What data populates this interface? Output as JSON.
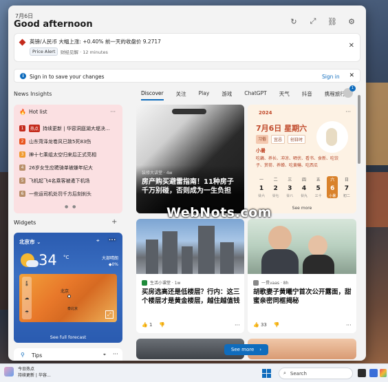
{
  "header": {
    "date": "7月6日",
    "greeting": "Good afternoon"
  },
  "alert": {
    "text": "英镑/人民币 大幅上涨: +0.40% 前一天的收盘价 9.2717",
    "pill": "Price Alert",
    "source": "财经见解 · 12 minutes"
  },
  "signin": {
    "text": "Sign in to save your changes",
    "link": "Sign in"
  },
  "left": {
    "news_label": "News Insights",
    "widgets_label": "Widgets"
  },
  "tabs": [
    "Discover",
    "关注",
    "Play",
    "游戏",
    "ChatGPT",
    "天气",
    "抖音",
    "携程旅行"
  ],
  "hotlist": {
    "title": "Hot list",
    "badge": "热点",
    "items": [
      {
        "rank": "1",
        "text": "持续更新 | 华容洞庭湖大堤决…",
        "color": "#c42b1c"
      },
      {
        "rank": "2",
        "text": "山东菏泽龙卷风已致5死83伤",
        "color": "#e8551f"
      },
      {
        "rank": "3",
        "text": "神十七乘组太空归来后正式亮相",
        "color": "#f09a2f"
      },
      {
        "rank": "4",
        "text": "26岁女生应聘骑单被嫌年纪大",
        "color": "#b88f6a"
      },
      {
        "rank": "5",
        "text": "飞机起飞4名乘客被遣下机场",
        "color": "#b88f6a"
      },
      {
        "rank": "6",
        "text": "一些运司机处罚千方后刻刹头",
        "color": "#b88f6a"
      }
    ]
  },
  "weather": {
    "city": "北京市",
    "temp": "34",
    "unit": "°C",
    "cond1": "大部晴朗",
    "cond2": "◆0%",
    "map_label": "北京",
    "map_sub": "泰北京",
    "forecast": "See full forecast"
  },
  "tips": {
    "label": "Tips"
  },
  "card_main": {
    "source": "装修大讲堂 · 4w",
    "title": "房产购买避雷指南！11种房子千万别碰，否则成为一生负担"
  },
  "calendar": {
    "year": "2024",
    "date": "7月6日 星期六",
    "yi": "习俗",
    "tag1": "宜忌",
    "tag2": "创日时",
    "season": "小暑",
    "acts": "吃藕、养长、冲凉、晒伏、看书、食新、吃饺子、赏荷、养蝉、吃黄鳝、吃西瓜",
    "days": [
      {
        "w": "一",
        "d": "1",
        "l": "廿六"
      },
      {
        "w": "二",
        "d": "2",
        "l": "廿七"
      },
      {
        "w": "三",
        "d": "3",
        "l": "廿八"
      },
      {
        "w": "四",
        "d": "4",
        "l": "廿九"
      },
      {
        "w": "五",
        "d": "5",
        "l": "三十"
      },
      {
        "w": "六",
        "d": "6",
        "l": "小暑"
      },
      {
        "w": "日",
        "d": "7",
        "l": "初二"
      }
    ],
    "see_more": "See more"
  },
  "card_a": {
    "source": "生活小课堂 · 1w",
    "title": "买房选高还是低楼层？行内：这三个楼层才是黄金楼层，越住越值钱",
    "likes": "1"
  },
  "card_b": {
    "source": "一贯vaas · 8h",
    "title": "胡歌妻子黄曦宁首次公开露面，甜蜜亲密同框揭秘",
    "likes": "33"
  },
  "see_more_btn": "See more",
  "watermark": "WebNots.com",
  "taskbar": {
    "news1": "今日热点",
    "news2": "持续更新 | 华容…",
    "search": "Search"
  },
  "colors": {
    "accent": "#0f6cbd",
    "alert": "#c42b1c"
  }
}
